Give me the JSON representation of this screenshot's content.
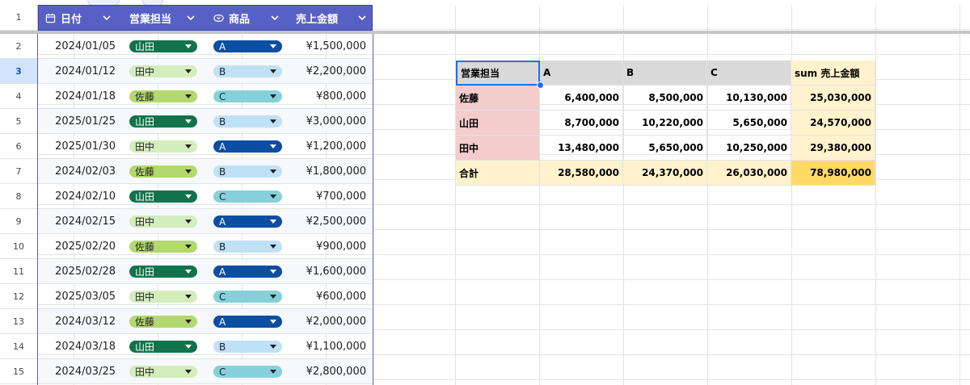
{
  "sheet": {
    "row_numbers": [
      "1",
      "2",
      "3",
      "4",
      "5",
      "6",
      "7",
      "8",
      "9",
      "10",
      "11",
      "12",
      "13",
      "14",
      "15"
    ],
    "active_row": "3",
    "icons": {
      "date_column": "calendar-icon",
      "product_column": "dropdown-chip-icon",
      "column_menu": "chevron-down-icon"
    }
  },
  "table": {
    "headers": {
      "date": "日付",
      "rep": "営業担当",
      "product": "商品",
      "amount": "売上金額"
    },
    "rows": [
      {
        "date": "2024/01/05",
        "rep": "山田",
        "product": "A",
        "amount": "¥1,500,000"
      },
      {
        "date": "2024/01/12",
        "rep": "田中",
        "product": "B",
        "amount": "¥2,200,000"
      },
      {
        "date": "2024/01/18",
        "rep": "佐藤",
        "product": "C",
        "amount": "¥800,000"
      },
      {
        "date": "2025/01/25",
        "rep": "山田",
        "product": "B",
        "amount": "¥3,000,000"
      },
      {
        "date": "2025/01/30",
        "rep": "田中",
        "product": "A",
        "amount": "¥1,200,000"
      },
      {
        "date": "2024/02/03",
        "rep": "佐藤",
        "product": "B",
        "amount": "¥1,800,000"
      },
      {
        "date": "2024/02/10",
        "rep": "山田",
        "product": "C",
        "amount": "¥700,000"
      },
      {
        "date": "2024/02/15",
        "rep": "田中",
        "product": "A",
        "amount": "¥2,500,000"
      },
      {
        "date": "2025/02/20",
        "rep": "佐藤",
        "product": "B",
        "amount": "¥900,000"
      },
      {
        "date": "2025/02/28",
        "rep": "山田",
        "product": "A",
        "amount": "¥1,600,000"
      },
      {
        "date": "2025/03/05",
        "rep": "田中",
        "product": "C",
        "amount": "¥600,000"
      },
      {
        "date": "2024/03/12",
        "rep": "佐藤",
        "product": "A",
        "amount": "¥2,000,000"
      },
      {
        "date": "2024/03/18",
        "rep": "山田",
        "product": "B",
        "amount": "¥1,100,000"
      },
      {
        "date": "2024/03/25",
        "rep": "田中",
        "product": "C",
        "amount": "¥2,800,000"
      }
    ],
    "chip_colors": {
      "rep": {
        "山田": "#11734b",
        "田中": "#d4edbc",
        "佐藤": "#b3d96e"
      },
      "product": {
        "A": "#0b4ea2",
        "B": "#bfe1f6",
        "C": "#86d1d9"
      }
    },
    "header_color": "#5760c4"
  },
  "pivot": {
    "header": [
      "営業担当",
      "A",
      "B",
      "C",
      "sum 売上金額"
    ],
    "rows": [
      [
        "佐藤",
        "6,400,000",
        "8,500,000",
        "10,130,000",
        "25,030,000"
      ],
      [
        "山田",
        "8,700,000",
        "10,220,000",
        "5,650,000",
        "24,570,000"
      ],
      [
        "田中",
        "13,480,000",
        "5,650,000",
        "10,250,000",
        "29,380,000"
      ]
    ],
    "total": [
      "合計",
      "28,580,000",
      "24,370,000",
      "26,030,000",
      "78,980,000"
    ],
    "colors": {
      "header_bg": "#d9d9d9",
      "header_total_bg": "#fff2cc",
      "row_label_bg": "#f4cccc",
      "total_row_bg": "#fff2cc",
      "grand_total_bg": "#ffd966",
      "selection": "#1a73e8"
    }
  }
}
